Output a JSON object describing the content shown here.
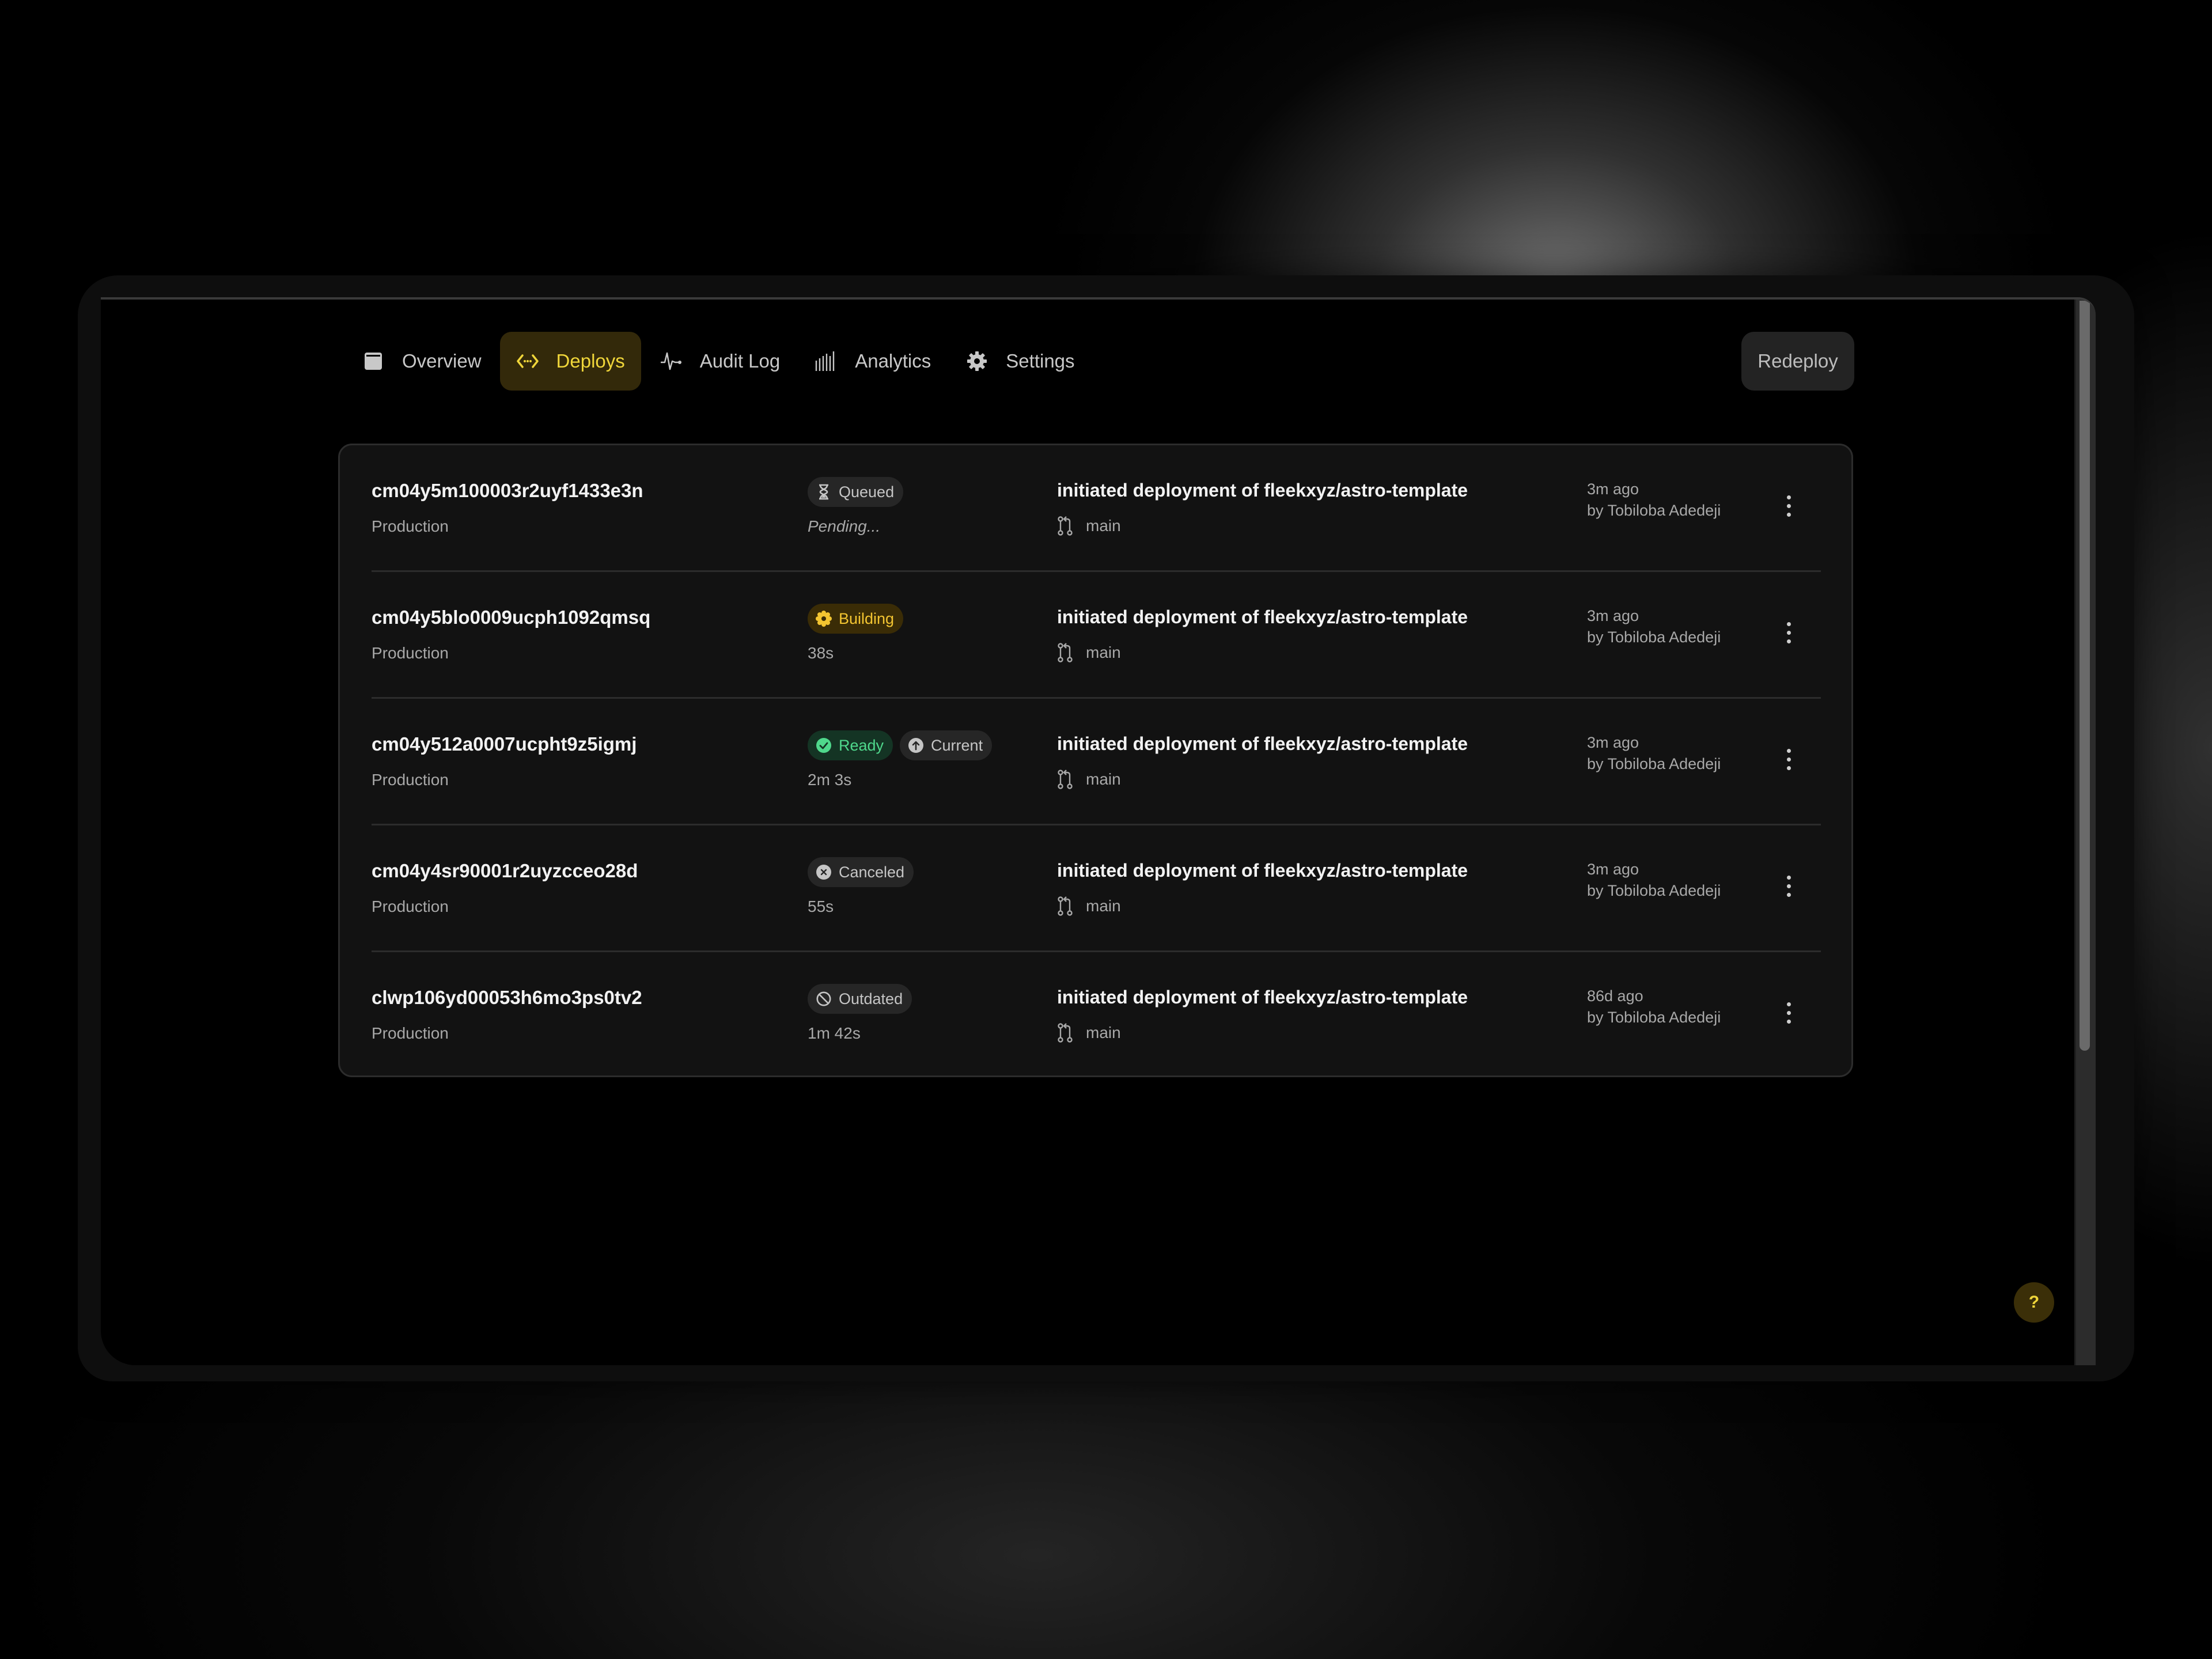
{
  "nav": {
    "tabs": [
      {
        "label": "Overview",
        "icon": "browser-window-icon",
        "active": false
      },
      {
        "label": "Deploys",
        "icon": "code-brackets-icon",
        "active": true
      },
      {
        "label": "Audit Log",
        "icon": "pulse-icon",
        "active": false
      },
      {
        "label": "Analytics",
        "icon": "bar-chart-icon",
        "active": false
      },
      {
        "label": "Settings",
        "icon": "gear-icon",
        "active": false
      }
    ],
    "redeploy_label": "Redeploy"
  },
  "colors": {
    "accent": "#f0d63a",
    "accent_bg": "#33290a",
    "building": "#f3c531",
    "ready": "#4fd88c",
    "neutral_badge": "#262626"
  },
  "deploys": [
    {
      "id": "cm04y5m100003r2uyf1433e3n",
      "environment": "Production",
      "badges": [
        {
          "label": "Queued",
          "icon": "hourglass-icon",
          "kind": "queued"
        }
      ],
      "duration": "Pending...",
      "message": "initiated deployment of fleekxyz/astro-template",
      "branch": "main",
      "time": "3m ago",
      "author": "by Tobiloba Adedeji"
    },
    {
      "id": "cm04y5blo0009ucph1092qmsq",
      "environment": "Production",
      "badges": [
        {
          "label": "Building",
          "icon": "gear-spinner-icon",
          "kind": "building"
        }
      ],
      "duration": "38s",
      "message": "initiated deployment of fleekxyz/astro-template",
      "branch": "main",
      "time": "3m ago",
      "author": "by Tobiloba Adedeji"
    },
    {
      "id": "cm04y512a0007ucpht9z5igmj",
      "environment": "Production",
      "badges": [
        {
          "label": "Ready",
          "icon": "check-circle-icon",
          "kind": "ready"
        },
        {
          "label": "Current",
          "icon": "arrow-up-circle-icon",
          "kind": "current"
        }
      ],
      "duration": "2m 3s",
      "message": "initiated deployment of fleekxyz/astro-template",
      "branch": "main",
      "time": "3m ago",
      "author": "by Tobiloba Adedeji"
    },
    {
      "id": "cm04y4sr90001r2uyzcceo28d",
      "environment": "Production",
      "badges": [
        {
          "label": "Canceled",
          "icon": "x-circle-icon",
          "kind": "canceled"
        }
      ],
      "duration": "55s",
      "message": "initiated deployment of fleekxyz/astro-template",
      "branch": "main",
      "time": "3m ago",
      "author": "by Tobiloba Adedeji"
    },
    {
      "id": "clwp106yd00053h6mo3ps0tv2",
      "environment": "Production",
      "badges": [
        {
          "label": "Outdated",
          "icon": "prohibited-icon",
          "kind": "outdated"
        }
      ],
      "duration": "1m 42s",
      "message": "initiated deployment of fleekxyz/astro-template",
      "branch": "main",
      "time": "86d ago",
      "author": "by Tobiloba Adedeji"
    }
  ],
  "help_label": "?"
}
